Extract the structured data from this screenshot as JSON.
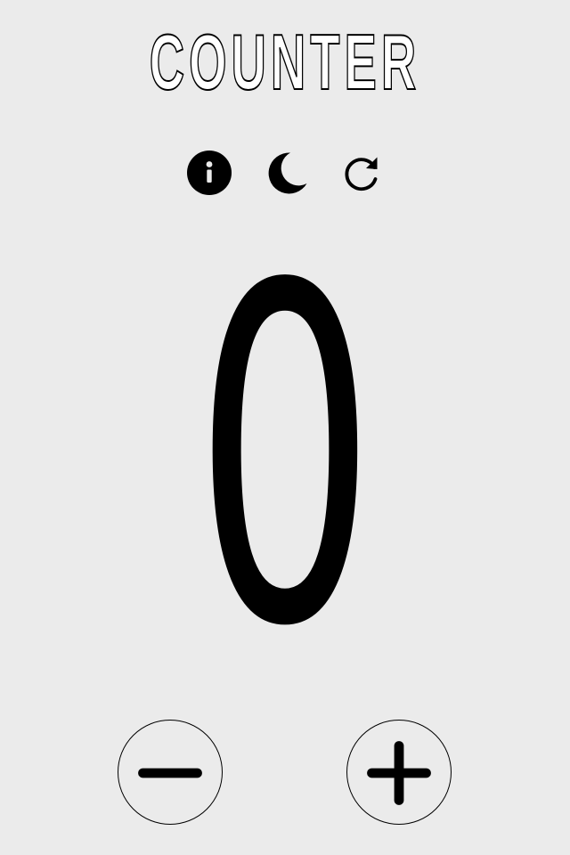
{
  "app": {
    "title": "COUNTER",
    "count": "0"
  },
  "toolbar": {
    "icons": [
      "info-icon",
      "moon-icon",
      "refresh-icon"
    ]
  },
  "controls": {
    "decrement_icon": "minus-icon",
    "increment_icon": "plus-icon"
  },
  "colors": {
    "background": "#ebebeb",
    "foreground": "#000000"
  }
}
